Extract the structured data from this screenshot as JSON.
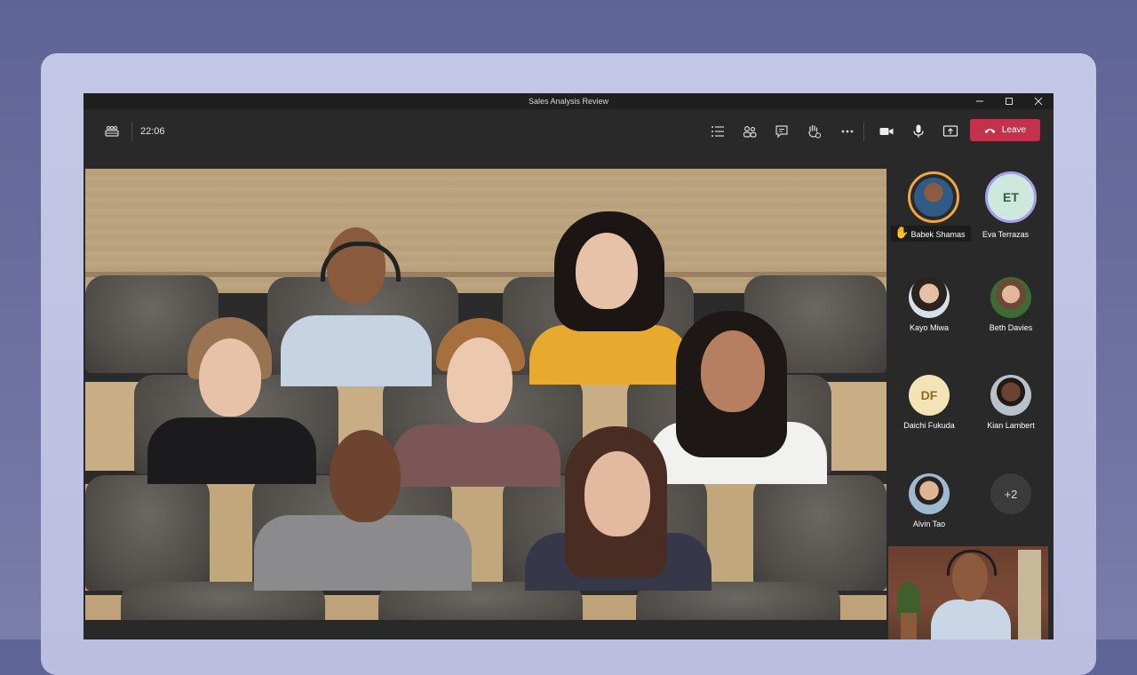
{
  "window": {
    "title": "Sales Analysis Review",
    "controls": [
      "minimize-icon",
      "maximize-icon",
      "close-icon"
    ]
  },
  "toolbar": {
    "time": "22:06",
    "left_icon": "together-mode-icon",
    "icons": [
      "participants-list-icon",
      "people-icon",
      "chat-icon",
      "raise-hand-icon",
      "more-icon",
      "camera-icon",
      "microphone-icon",
      "share-screen-icon"
    ],
    "leave_label": "Leave",
    "leave_color": "#c4314b"
  },
  "participants": [
    {
      "name": "Babek Shamas",
      "type": "photo",
      "ring": "#f0a742",
      "raised_hand": true
    },
    {
      "name": "Eva Terrazas",
      "initials": "ET",
      "type": "initials",
      "bg": "#cfe8dd",
      "fg": "#2c5e4c",
      "ring": "#a3a2e8"
    },
    {
      "name": "Kayo Miwa",
      "type": "photo"
    },
    {
      "name": "Beth Davies",
      "type": "photo"
    },
    {
      "name": "Daichi Fukuda",
      "initials": "DF",
      "type": "initials",
      "bg": "#f3e3b6",
      "fg": "#8a6a25"
    },
    {
      "name": "Kian Lambert",
      "type": "photo"
    },
    {
      "name": "Alvin Tao",
      "type": "photo"
    }
  ],
  "overflow": {
    "label": "+2"
  }
}
